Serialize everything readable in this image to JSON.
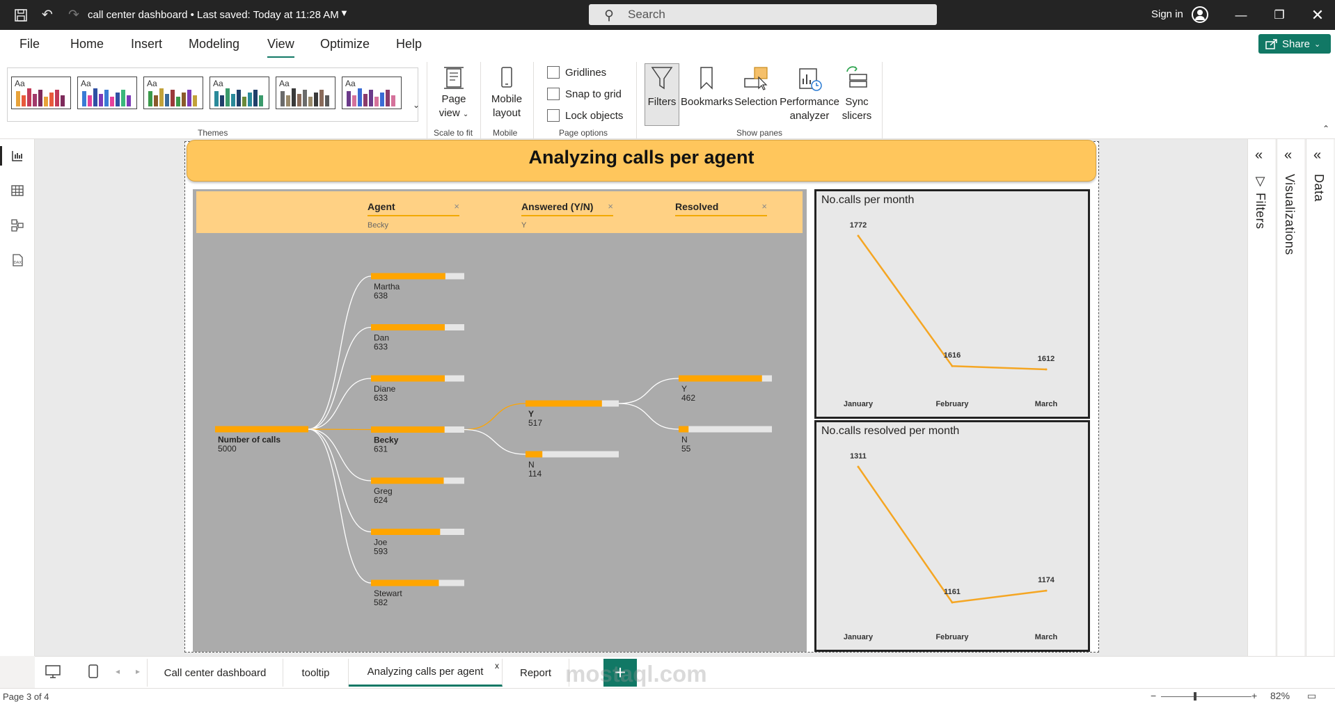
{
  "titlebar": {
    "doc_title": "call center dashboard • Last saved: Today at 11:28 AM",
    "search_placeholder": "Search",
    "signin": "Sign in"
  },
  "menu": [
    "File",
    "Home",
    "Insert",
    "Modeling",
    "View",
    "Optimize",
    "Help"
  ],
  "share_label": "Share",
  "ribbon": {
    "themes_label": "Themes",
    "theme_sample": "Aa",
    "page_view": "Page view",
    "scale_label": "Scale to fit",
    "mobile_layout": "Mobile layout",
    "mobile_label": "Mobile",
    "gridlines": "Gridlines",
    "snap": "Snap to grid",
    "lock": "Lock objects",
    "page_options_label": "Page options",
    "filters": "Filters",
    "bookmarks": "Bookmarks",
    "selection": "Selection",
    "perf": "Performance analyzer",
    "sync": "Sync slicers",
    "show_panes_label": "Show panes"
  },
  "page": {
    "title": "Analyzing calls per agent"
  },
  "decomp": {
    "levels": [
      {
        "name": "Agent",
        "value": "Becky"
      },
      {
        "name": "Answered (Y/N)",
        "value": "Y"
      },
      {
        "name": "Resolved",
        "value": ""
      }
    ],
    "root": {
      "label": "Number of calls",
      "value": "5000"
    },
    "agents": [
      {
        "name": "Martha",
        "value": "638"
      },
      {
        "name": "Dan",
        "value": "633"
      },
      {
        "name": "Diane",
        "value": "633"
      },
      {
        "name": "Becky",
        "value": "631"
      },
      {
        "name": "Greg",
        "value": "624"
      },
      {
        "name": "Joe",
        "value": "593"
      },
      {
        "name": "Stewart",
        "value": "582"
      }
    ],
    "answered": [
      {
        "name": "Y",
        "value": "517"
      },
      {
        "name": "N",
        "value": "114"
      }
    ],
    "resolved": [
      {
        "name": "Y",
        "value": "462"
      },
      {
        "name": "N",
        "value": "55"
      }
    ]
  },
  "chart_data": [
    {
      "type": "line",
      "title": "No.calls per month",
      "categories": [
        "January",
        "February",
        "March"
      ],
      "values": [
        1772,
        1616,
        1612
      ],
      "color": "#f5a623"
    },
    {
      "type": "line",
      "title": "No.calls resolved per month",
      "categories": [
        "January",
        "February",
        "March"
      ],
      "values": [
        1311,
        1161,
        1174
      ],
      "color": "#f5a623"
    }
  ],
  "panes": [
    "Filters",
    "Visualizations",
    "Data"
  ],
  "tabs": [
    "Call center dashboard",
    "tooltip",
    "Analyzing calls per agent",
    "Report"
  ],
  "tab_close": "x",
  "watermark": "mostaql.com",
  "status": {
    "page": "Page 3 of 4",
    "zoom": "82%"
  },
  "colors": {
    "accent": "#117865",
    "banner": "#ffc65c",
    "bar_orange": "#ffa500"
  }
}
